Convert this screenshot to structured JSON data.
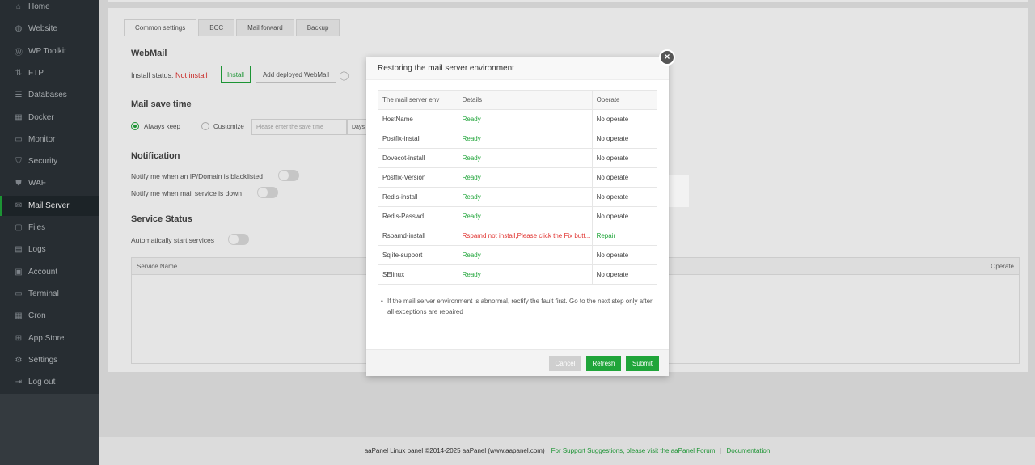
{
  "sidebar": {
    "items": [
      {
        "label": "Home",
        "icon": "home-icon",
        "glyph": "⌂"
      },
      {
        "label": "Website",
        "icon": "globe-icon",
        "glyph": "◍"
      },
      {
        "label": "WP Toolkit",
        "icon": "wordpress-icon",
        "glyph": "Ⓦ"
      },
      {
        "label": "FTP",
        "icon": "ftp-icon",
        "glyph": "⇅"
      },
      {
        "label": "Databases",
        "icon": "database-icon",
        "glyph": "☰"
      },
      {
        "label": "Docker",
        "icon": "docker-icon",
        "glyph": "▦"
      },
      {
        "label": "Monitor",
        "icon": "monitor-icon",
        "glyph": "▭"
      },
      {
        "label": "Security",
        "icon": "shield-icon",
        "glyph": "⛉"
      },
      {
        "label": "WAF",
        "icon": "waf-shield-icon",
        "glyph": "⛊"
      },
      {
        "label": "Mail Server",
        "icon": "mail-icon",
        "glyph": "✉"
      },
      {
        "label": "Files",
        "icon": "folder-icon",
        "glyph": "▢"
      },
      {
        "label": "Logs",
        "icon": "logs-icon",
        "glyph": "▤"
      },
      {
        "label": "Account",
        "icon": "account-icon",
        "glyph": "▣"
      },
      {
        "label": "Terminal",
        "icon": "terminal-icon",
        "glyph": "▭"
      },
      {
        "label": "Cron",
        "icon": "calendar-icon",
        "glyph": "▦"
      },
      {
        "label": "App Store",
        "icon": "grid-icon",
        "glyph": "⊞"
      },
      {
        "label": "Settings",
        "icon": "gear-icon",
        "glyph": "⚙"
      },
      {
        "label": "Log out",
        "icon": "logout-icon",
        "glyph": "⇥"
      }
    ],
    "active_index": 9
  },
  "tabs": [
    "Common settings",
    "BCC",
    "Mail forward",
    "Backup"
  ],
  "webmail": {
    "title": "WebMail",
    "status_label": "Install status:",
    "status_value": "Not install",
    "install_button": "Install",
    "add_deployed_button": "Add deployed WebMail",
    "info_glyph": "ⓘ"
  },
  "save_time": {
    "title": "Mail save time",
    "always_keep": "Always keep",
    "customize": "Customize",
    "input_placeholder": "Please enter the save time",
    "unit": "Days"
  },
  "notification": {
    "title": "Notification",
    "blacklisted": "Notify me when an IP/Domain is blacklisted",
    "service_down": "Notify me when mail service is down"
  },
  "service_status": {
    "title": "Service Status",
    "auto_start": "Automatically start services",
    "col_name": "Service Name",
    "col_operate": "Operate"
  },
  "footer": {
    "copyright": "aaPanel Linux panel ©2014-2025 aaPanel (www.aapanel.com)",
    "support": "For Support Suggestions, please visit the aaPanel Forum",
    "docs": "Documentation"
  },
  "modal": {
    "title": "Restoring the mail server environment",
    "close": "×",
    "columns": [
      "The mail server env",
      "Details",
      "Operate"
    ],
    "rows": [
      {
        "env": "HostName",
        "details": "Ready",
        "operate": "No operate",
        "status": "ok"
      },
      {
        "env": "Postfix-install",
        "details": "Ready",
        "operate": "No operate",
        "status": "ok"
      },
      {
        "env": "Dovecot-install",
        "details": "Ready",
        "operate": "No operate",
        "status": "ok"
      },
      {
        "env": "Postfix-Version",
        "details": "Ready",
        "operate": "No operate",
        "status": "ok"
      },
      {
        "env": "Redis-install",
        "details": "Ready",
        "operate": "No operate",
        "status": "ok"
      },
      {
        "env": "Redis-Passwd",
        "details": "Ready",
        "operate": "No operate",
        "status": "ok"
      },
      {
        "env": "Rspamd-install",
        "details": "Rspamd not install,Please click the Fix butt...",
        "operate": "Repair",
        "status": "bad"
      },
      {
        "env": "Sqlite-support",
        "details": "Ready",
        "operate": "No operate",
        "status": "ok"
      },
      {
        "env": "SElinux",
        "details": "Ready",
        "operate": "No operate",
        "status": "ok"
      }
    ],
    "note": "If the mail server environment is abnormal, rectify the fault first. Go to the next step only after all exceptions are repaired",
    "cancel": "Cancel",
    "refresh": "Refresh",
    "submit": "Submit"
  },
  "colors": {
    "accent": "#20a53a",
    "error": "#e0312e",
    "sidebar": "#2c3338"
  }
}
